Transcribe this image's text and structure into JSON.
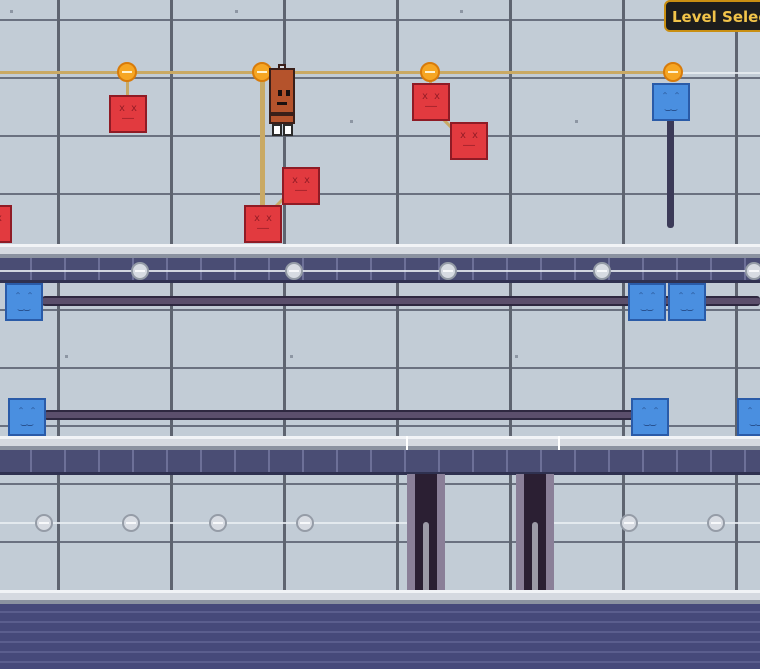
{
  "ui": {
    "level_select_label": "Level Select"
  },
  "glyphs": {
    "dead_face": "x x\n——",
    "happy_face": "ᵔ ᵔ\n‿‿"
  },
  "palette": {
    "wall": "#c2ccd6",
    "wire": "#c9a964",
    "node": "#f6a623",
    "red_block": "#e23a3f",
    "blue_block": "#4a8fe0",
    "floor_band": "#4a4d74",
    "button_text": "#f2c44a"
  },
  "icons": {
    "player": "sausage-character",
    "red_block": "dead-face-block",
    "blue_block": "smiley-face-block",
    "node": "wire-node",
    "knob": "rail-knob"
  }
}
